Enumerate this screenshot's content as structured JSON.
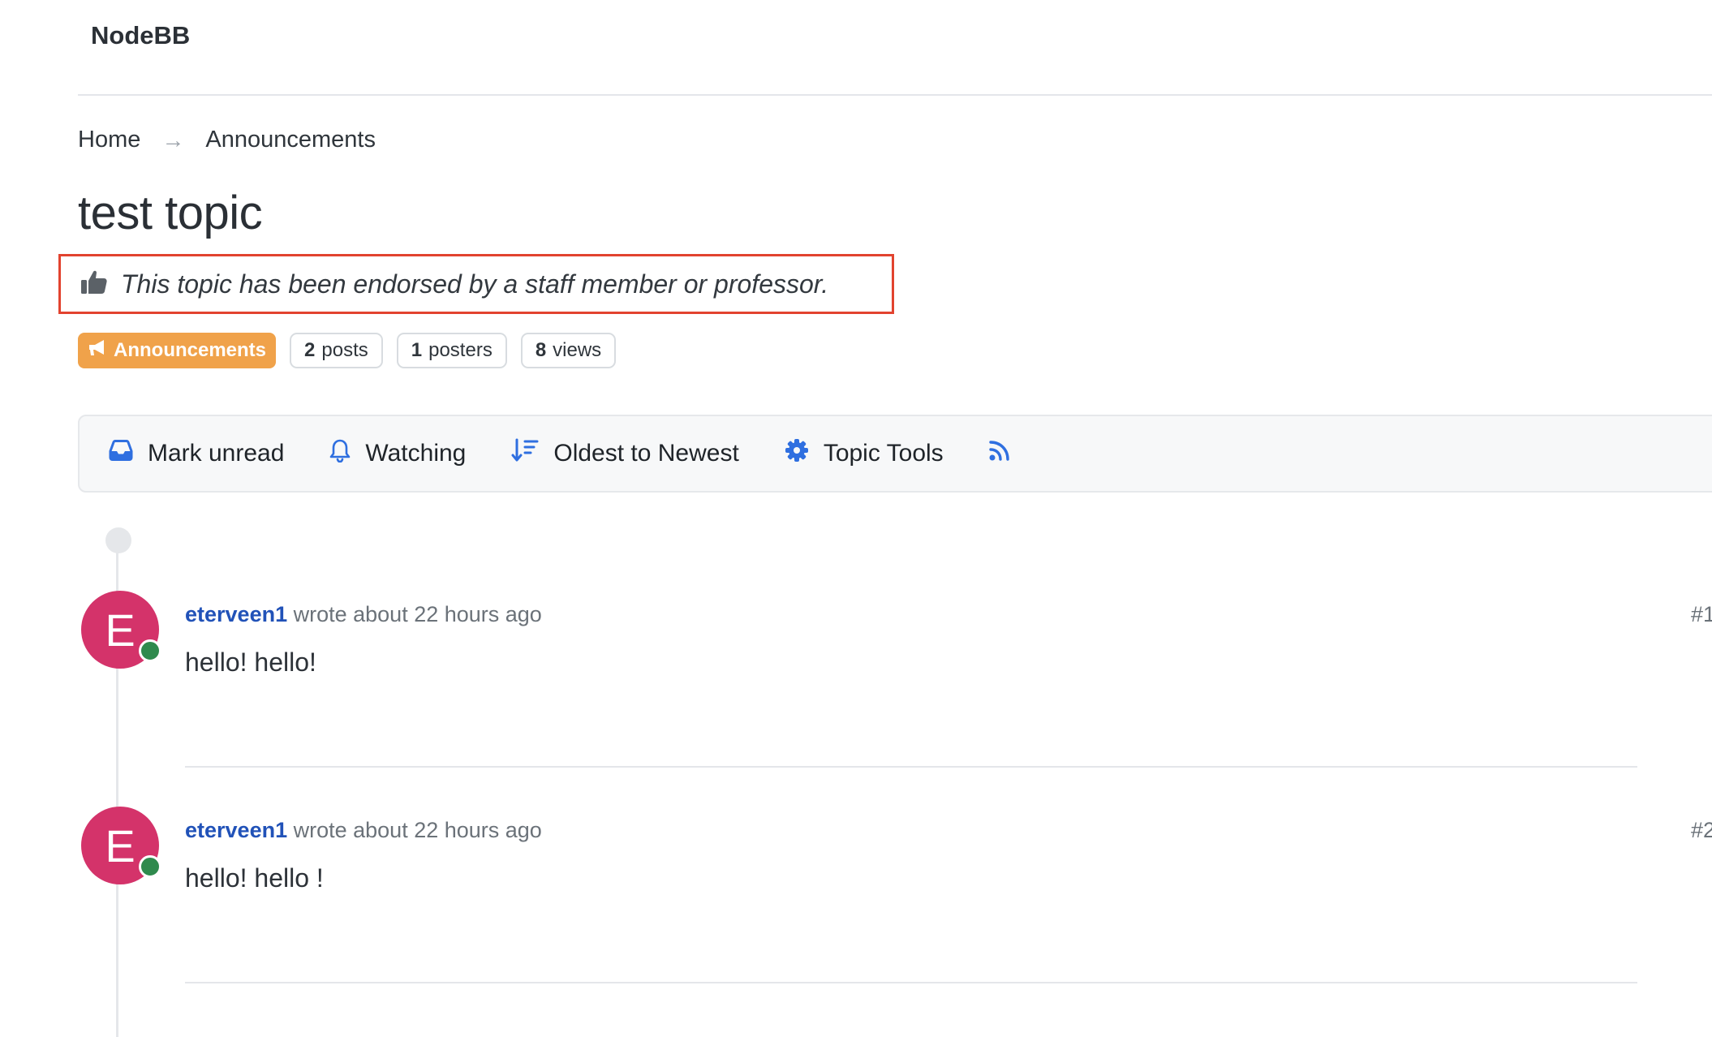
{
  "header": {
    "brand": "NodeBB"
  },
  "breadcrumb": {
    "home": "Home",
    "separator": "→",
    "current": "Announcements"
  },
  "topic": {
    "title": "test topic",
    "endorsement": "This topic has been endorsed by a staff member or professor.",
    "category": "Announcements",
    "stats": {
      "posts_count": "2",
      "posts_label": "posts",
      "posters_count": "1",
      "posters_label": "posters",
      "views_count": "8",
      "views_label": "views"
    }
  },
  "toolbar": {
    "mark_unread": "Mark unread",
    "watching": "Watching",
    "sort": "Oldest to Newest",
    "topic_tools": "Topic Tools"
  },
  "posts": [
    {
      "avatar_letter": "E",
      "author": "eterveen1",
      "meta": "wrote about 22 hours ago",
      "index": "#1",
      "content": "hello! hello!"
    },
    {
      "avatar_letter": "E",
      "author": "eterveen1",
      "meta": "wrote about 22 hours ago",
      "index": "#2",
      "content": "hello! hello !"
    }
  ],
  "colors": {
    "category_badge": "#f0a24a",
    "avatar": "#d4336a",
    "online_status": "#2f8a4d",
    "link": "#2152b8",
    "highlight_border": "#e2432f",
    "toolbar_icon": "#2f6fe0"
  },
  "icons": {
    "endorse": "thumbs-up-icon",
    "category": "bullhorn-icon",
    "mark_unread": "inbox-icon",
    "watching": "bell-icon",
    "sort": "sort-arrow-icon",
    "tools": "gear-icon",
    "rss": "rss-icon"
  }
}
